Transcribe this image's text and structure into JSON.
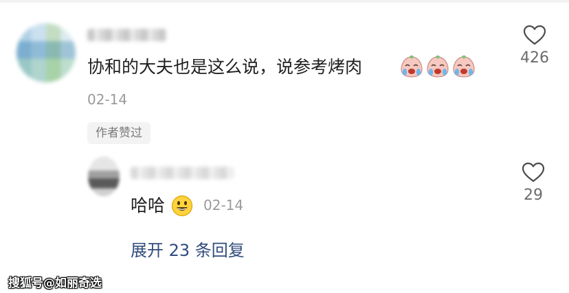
{
  "comment": {
    "text": "协和的大夫也是这么说，说参考烤肉",
    "emojis": [
      "crying-face-emoji",
      "crying-face-emoji",
      "crying-face-emoji"
    ],
    "date": "02-14",
    "like_count": "426",
    "author_liked_badge": "作者赞过"
  },
  "reply": {
    "text": "哈哈",
    "emoji": "smiling-face-emoji",
    "date": "02-14",
    "like_count": "29"
  },
  "expand_label": "展开 23 条回复",
  "watermark": "搜狐号@如丽奇选",
  "colors": {
    "text": "#1f1f1f",
    "meta": "#9a9a9a",
    "link": "#2f4b7c",
    "badge_bg": "#f3f3f3"
  }
}
